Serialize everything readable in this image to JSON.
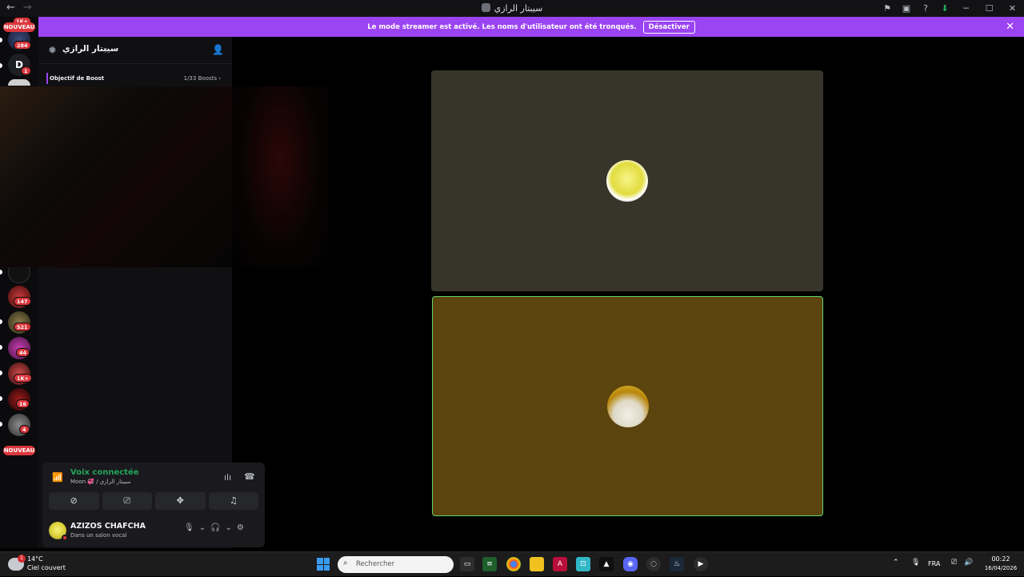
{
  "titlebar": {
    "back": "←",
    "forward": "→",
    "title": "سيبتار الرازي",
    "tools": {
      "inbox": "⚑",
      "screen": "▣",
      "help": "?",
      "download": "⬇",
      "minimize": "─",
      "maximize": "☐",
      "close": "✕"
    }
  },
  "banner": {
    "message": "Le mode streamer est activé. Les noms d'utilisateur ont été tronqués.",
    "button": "Désactiver",
    "close": "✕"
  },
  "rail": {
    "nouveau_top": "NOUVEAU",
    "nouveau_bottom": "NOUVEAU",
    "servers": [
      {
        "badge": "1K+"
      },
      {
        "badge": "284"
      },
      {
        "letter": "D",
        "badge": "1"
      },
      {
        "badge": "147"
      },
      {
        "badge": "521"
      },
      {
        "badge": "44"
      },
      {
        "badge": "1K+"
      },
      {
        "badge": "16"
      },
      {
        "badge": "4"
      }
    ]
  },
  "server": {
    "name": "سيبتار الرازي",
    "boost_label": "Objectif de Boost",
    "boost_count": "1/33 Boosts ›"
  },
  "voice": {
    "status": "Voix connectée",
    "channel": "Moon 💞 / سيبتار الرازي"
  },
  "user": {
    "name": "AZIZOS CHAFCHA",
    "status": "Dans un salon vocal"
  },
  "taskbar": {
    "temp": "14°C",
    "weather": "Ciel couvert",
    "weather_badge": "1",
    "search_placeholder": "Rechercher",
    "lang": "FRA",
    "time": "00:22",
    "date": "16/04/2026"
  },
  "colors": {
    "accent": "#9b44f2",
    "voice_green": "#23a55a",
    "badge_red": "#da373c",
    "speaking_border": "#5fd36f"
  }
}
